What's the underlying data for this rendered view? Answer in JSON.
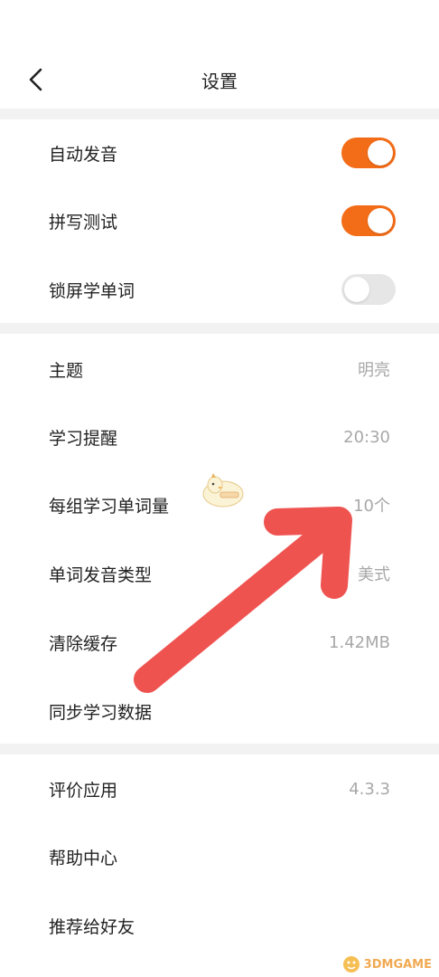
{
  "header": {
    "title": "设置",
    "back_icon": "chevron-left-icon"
  },
  "colors": {
    "accent": "#f36c17",
    "toggle_off": "#e6e6e6",
    "divider": "#f2f2f2",
    "secondary_text": "#a8a8a8",
    "annotation_arrow": "#ef5350"
  },
  "toggles": [
    {
      "label": "自动发音",
      "on": true
    },
    {
      "label": "拼写测试",
      "on": true
    },
    {
      "label": "锁屏学单词",
      "on": false
    }
  ],
  "settings": [
    {
      "label": "主题",
      "value": "明亮"
    },
    {
      "label": "学习提醒",
      "value": "20:30"
    },
    {
      "label": "每组学习单词量",
      "value": "10个"
    },
    {
      "label": "单词发音类型",
      "value": "美式"
    },
    {
      "label": "清除缓存",
      "value": "1.42MB"
    },
    {
      "label": "同步学习数据",
      "value": ""
    }
  ],
  "about": [
    {
      "label": "评价应用",
      "value": "4.3.3"
    },
    {
      "label": "帮助中心",
      "value": ""
    },
    {
      "label": "推荐给好友",
      "value": ""
    }
  ],
  "watermark": {
    "text": "3DMGAME"
  }
}
